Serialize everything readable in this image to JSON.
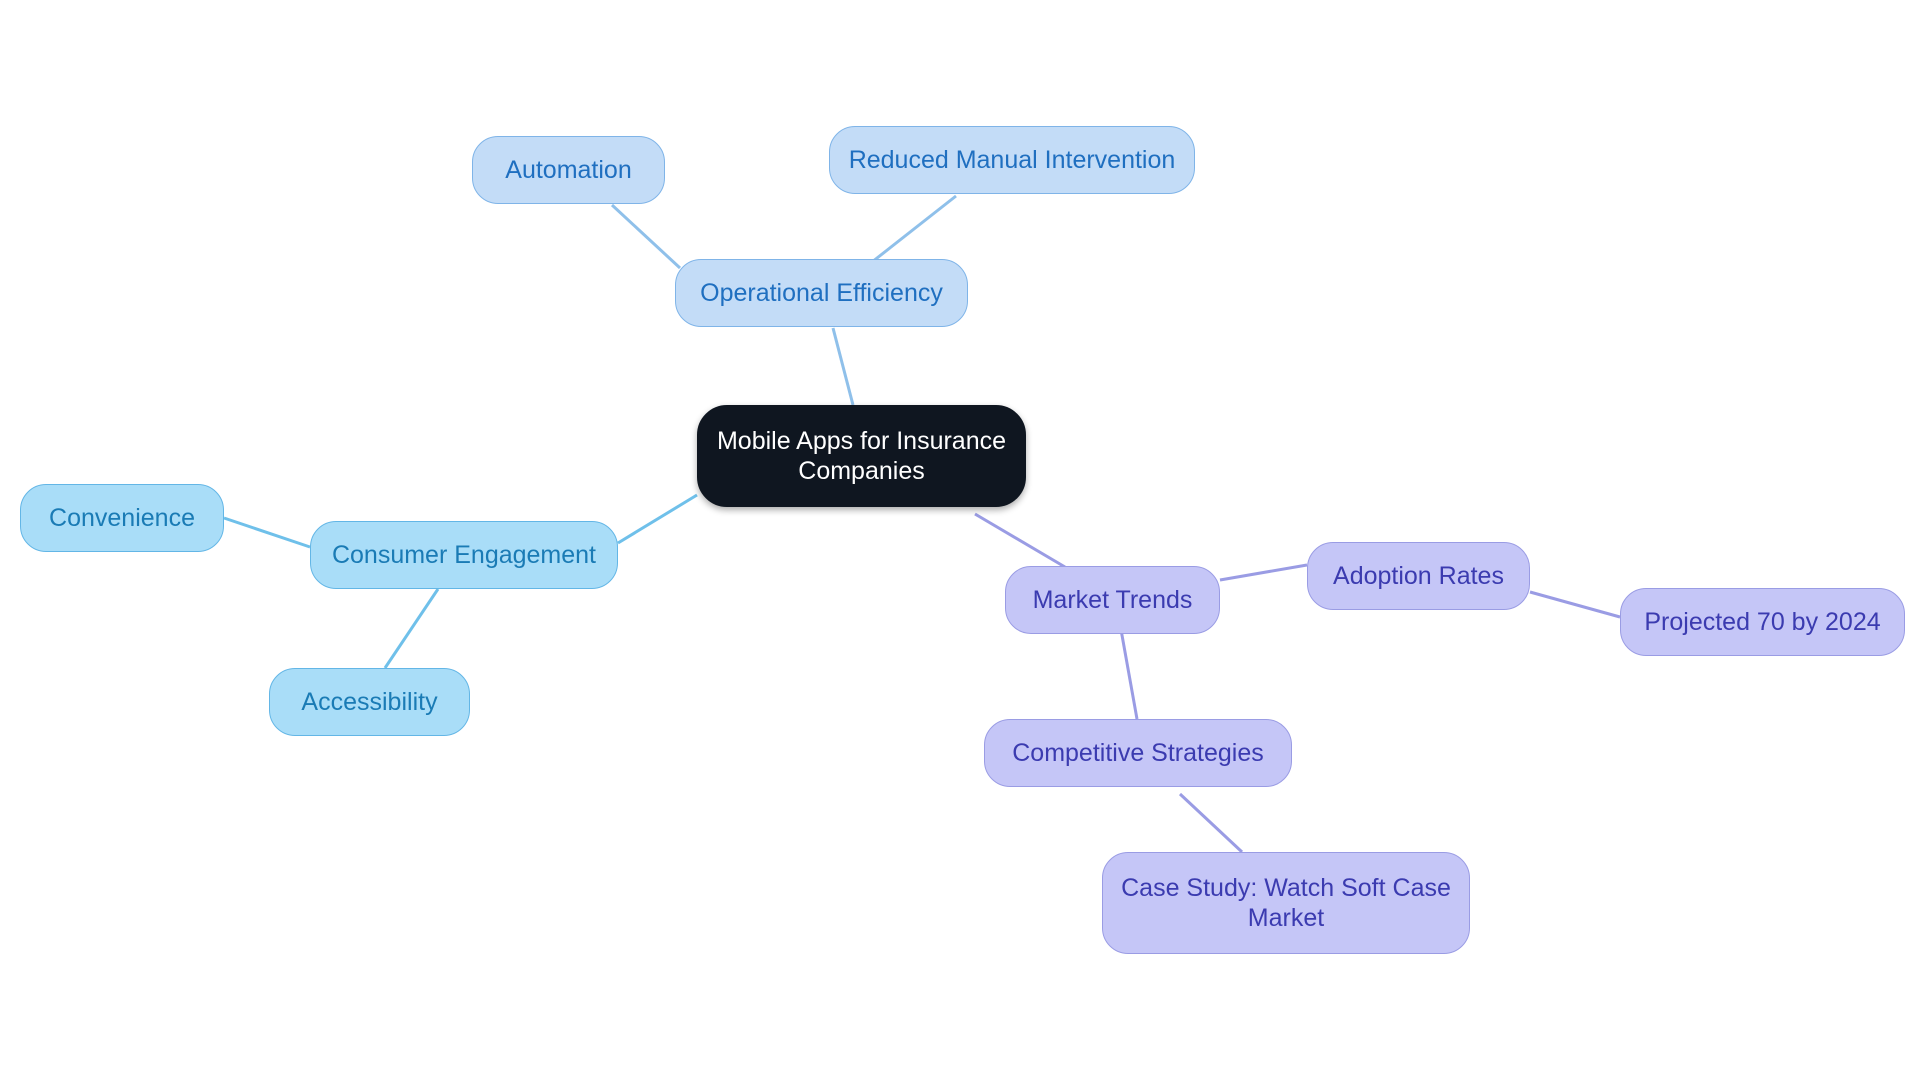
{
  "diagram": {
    "type": "mindmap",
    "background": "#ffffff",
    "root": {
      "id": "root",
      "label": "Mobile Apps for Insurance\nCompanies",
      "fill": "#0f1620",
      "text_color": "#ffffff"
    },
    "palette": {
      "blue_fill": "#c3dcf7",
      "blue_stroke": "#7fb4e8",
      "blue_text": "#1f6fc0",
      "cyan_fill": "#a9ddf8",
      "cyan_stroke": "#63b6e6",
      "cyan_text": "#1a7bb5",
      "purple_fill": "#c5c6f7",
      "purple_stroke": "#9a9ce4",
      "purple_text": "#3b3bb0"
    },
    "branches": [
      {
        "id": "operational-efficiency",
        "label": "Operational Efficiency",
        "color": "blue",
        "children": [
          {
            "id": "automation",
            "label": "Automation",
            "color": "blue"
          },
          {
            "id": "reduced-manual-intervention",
            "label": "Reduced Manual Intervention",
            "color": "blue"
          }
        ]
      },
      {
        "id": "consumer-engagement",
        "label": "Consumer Engagement",
        "color": "cyan",
        "children": [
          {
            "id": "convenience",
            "label": "Convenience",
            "color": "cyan"
          },
          {
            "id": "accessibility",
            "label": "Accessibility",
            "color": "cyan"
          }
        ]
      },
      {
        "id": "market-trends",
        "label": "Market Trends",
        "color": "purple",
        "children": [
          {
            "id": "adoption-rates",
            "label": "Adoption Rates",
            "color": "purple"
          },
          {
            "id": "projected-70-by-2024",
            "label": "Projected 70 by 2024",
            "color": "purple"
          },
          {
            "id": "competitive-strategies",
            "label": "Competitive Strategies",
            "color": "purple"
          },
          {
            "id": "case-study-watch-soft-case-market",
            "label": "Case Study: Watch Soft Case\nMarket",
            "color": "purple"
          }
        ]
      }
    ],
    "nodes": {
      "root": {
        "label": "Mobile Apps for Insurance\nCompanies"
      },
      "operational_efficiency": {
        "label": "Operational Efficiency"
      },
      "automation": {
        "label": "Automation"
      },
      "reduced_manual_intervention": {
        "label": "Reduced Manual Intervention"
      },
      "consumer_engagement": {
        "label": "Consumer Engagement"
      },
      "convenience": {
        "label": "Convenience"
      },
      "accessibility": {
        "label": "Accessibility"
      },
      "market_trends": {
        "label": "Market Trends"
      },
      "adoption_rates": {
        "label": "Adoption Rates"
      },
      "projected_70_by_2024": {
        "label": "Projected 70 by 2024"
      },
      "competitive_strategies": {
        "label": "Competitive Strategies"
      },
      "case_study": {
        "label": "Case Study: Watch Soft Case\nMarket"
      }
    }
  }
}
